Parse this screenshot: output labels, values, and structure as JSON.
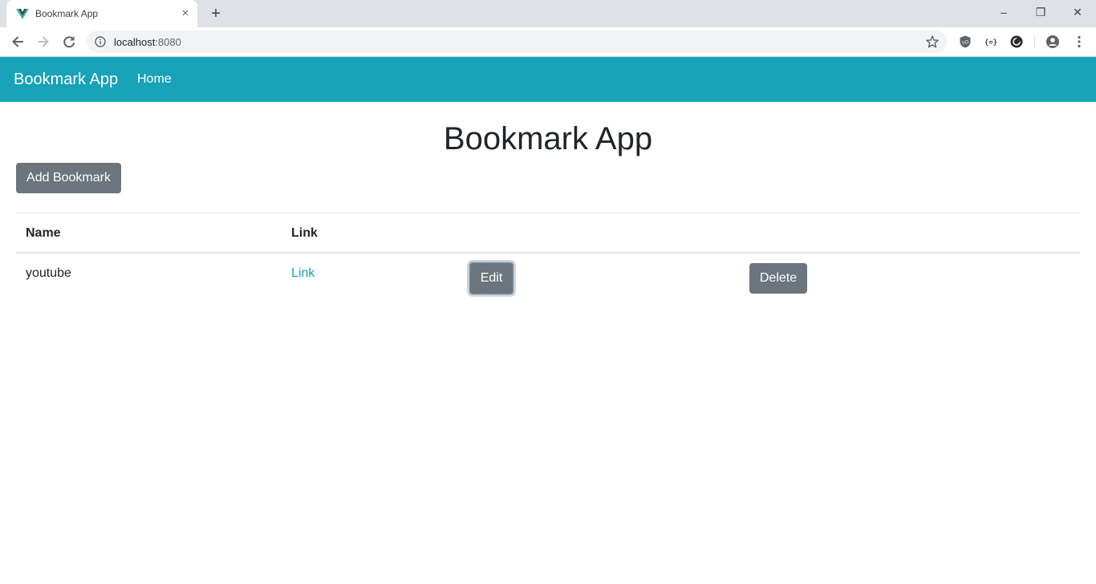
{
  "browser": {
    "tab": {
      "title": "Bookmark App",
      "favicon": "vue-logo-icon",
      "close_label": "×"
    },
    "new_tab_label": "+",
    "window_controls": {
      "minimize": "–",
      "maximize": "❐",
      "close": "✕"
    },
    "address_bar": {
      "host": "localhost",
      "port": ":8080"
    },
    "extensions": [
      "ublock-icon",
      "json-viewer-icon",
      "dark-reader-icon"
    ]
  },
  "navbar": {
    "brand": "Bookmark App",
    "links": [
      {
        "label": "Home"
      }
    ]
  },
  "main": {
    "title": "Bookmark App",
    "add_button_label": "Add Bookmark",
    "table": {
      "columns": [
        "Name",
        "Link"
      ],
      "rows": [
        {
          "name": "youtube",
          "link_label": "Link",
          "edit_label": "Edit",
          "delete_label": "Delete"
        }
      ]
    }
  },
  "colors": {
    "navbar": "#17a2b8",
    "button": "#6c757d",
    "link": "#17a2b8",
    "text": "#212529"
  }
}
